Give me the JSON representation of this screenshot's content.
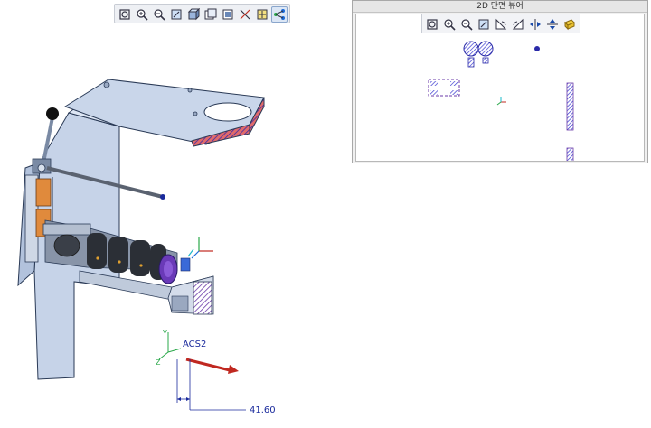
{
  "main_toolbar": {
    "buttons": [
      {
        "icon": "zoom-fit-icon"
      },
      {
        "icon": "zoom-in-icon"
      },
      {
        "icon": "zoom-out-icon"
      },
      {
        "icon": "repaint-icon"
      },
      {
        "icon": "shaded-view-icon"
      },
      {
        "icon": "saved-views-icon"
      },
      {
        "icon": "view-manager-icon"
      },
      {
        "icon": "datum-display-icon"
      },
      {
        "icon": "spin-center-icon"
      },
      {
        "icon": "model-tree-icon",
        "active": true
      }
    ]
  },
  "section_viewer": {
    "title": "2D 단면 뷰어",
    "toolbar": [
      {
        "icon": "zoom-fit-icon"
      },
      {
        "icon": "zoom-in-icon"
      },
      {
        "icon": "zoom-out-icon"
      },
      {
        "icon": "repaint-icon"
      },
      {
        "icon": "rotate-left-icon"
      },
      {
        "icon": "rotate-right-icon"
      },
      {
        "icon": "flip-horizontal-icon"
      },
      {
        "icon": "flip-vertical-icon"
      },
      {
        "icon": "section-color-icon"
      }
    ]
  },
  "model": {
    "csys_label": "ACS2",
    "dimension_value": "41.60",
    "colors": {
      "part_fill": "#c9d6ea",
      "part_edge": "#2a3a56",
      "hatch": "#6a3aa8",
      "cut_face": "#b0486a",
      "roller": "#2b2f36",
      "accent": "#e08a3c",
      "dimension": "#1a2a9c",
      "axis_red": "#c02820",
      "axis_green": "#2aa84a"
    }
  }
}
